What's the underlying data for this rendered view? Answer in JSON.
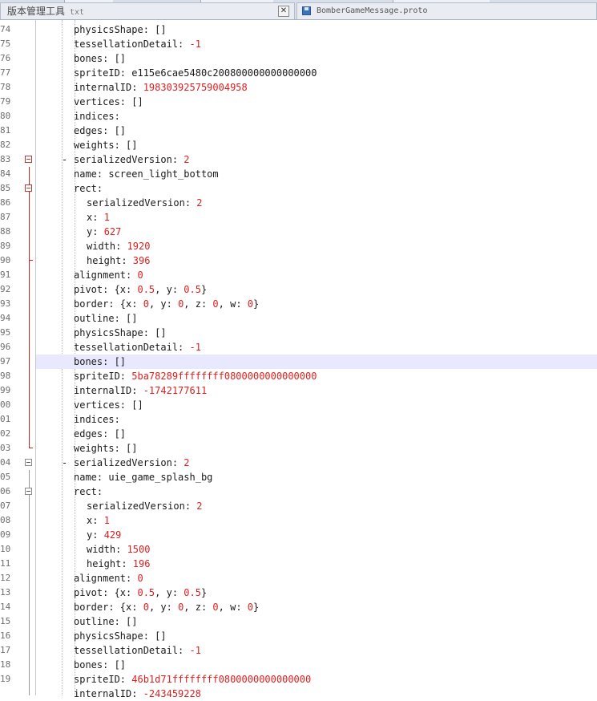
{
  "tabs": [
    {
      "label": "版本管理工具",
      "ext": "txt",
      "close": "✕"
    },
    {
      "label": "BomberGameMessage.proto"
    }
  ],
  "line_numbers": [
    "74",
    "75",
    "76",
    "77",
    "78",
    "79",
    "80",
    "81",
    "82",
    "83",
    "84",
    "85",
    "86",
    "87",
    "88",
    "89",
    "90",
    "91",
    "92",
    "93",
    "94",
    "95",
    "96",
    "97",
    "98",
    "99",
    "00",
    "01",
    "02",
    "03",
    "04",
    "05",
    "06",
    "07",
    "08",
    "09",
    "10",
    "11",
    "12",
    "13",
    "14",
    "15",
    "16",
    "17",
    "18",
    "19"
  ],
  "lines": [
    {
      "indent": 92,
      "dash": false,
      "key": "physicsShape: ",
      "val": "[]",
      "valColor": "k"
    },
    {
      "indent": 92,
      "dash": false,
      "key": "tessellationDetail: ",
      "val": "-1",
      "valColor": "n"
    },
    {
      "indent": 92,
      "dash": false,
      "key": "bones: ",
      "val": "[]",
      "valColor": "k"
    },
    {
      "indent": 92,
      "dash": false,
      "key": "spriteID: ",
      "val": "e115e6cae5480c200800000000000000",
      "valColor": "k"
    },
    {
      "indent": 92,
      "dash": false,
      "key": "internalID: ",
      "val": "198303925759004958",
      "valColor": "n"
    },
    {
      "indent": 92,
      "dash": false,
      "key": "vertices: ",
      "val": "[]",
      "valColor": "k"
    },
    {
      "indent": 92,
      "dash": false,
      "key": "indices:",
      "val": "",
      "valColor": "k"
    },
    {
      "indent": 92,
      "dash": false,
      "key": "edges: ",
      "val": "[]",
      "valColor": "k"
    },
    {
      "indent": 92,
      "dash": false,
      "key": "weights: ",
      "val": "[]",
      "valColor": "k"
    },
    {
      "indent": 92,
      "dash": true,
      "key": "serializedVersion: ",
      "val": "2",
      "valColor": "n"
    },
    {
      "indent": 92,
      "dash": false,
      "key": "name: ",
      "val": "screen_light_bottom",
      "valColor": "k"
    },
    {
      "indent": 92,
      "dash": false,
      "key": "rect:",
      "val": "",
      "valColor": "k"
    },
    {
      "indent": 108,
      "dash": false,
      "key": "serializedVersion: ",
      "val": "2",
      "valColor": "n"
    },
    {
      "indent": 108,
      "dash": false,
      "key": "x: ",
      "val": "1",
      "valColor": "n"
    },
    {
      "indent": 108,
      "dash": false,
      "key": "y: ",
      "val": "627",
      "valColor": "n"
    },
    {
      "indent": 108,
      "dash": false,
      "key": "width: ",
      "val": "1920",
      "valColor": "n"
    },
    {
      "indent": 108,
      "dash": false,
      "key": "height: ",
      "val": "396",
      "valColor": "n"
    },
    {
      "indent": 92,
      "dash": false,
      "key": "alignment: ",
      "val": "0",
      "valColor": "n"
    },
    {
      "indent": 92,
      "dash": false,
      "key": "pivot: ",
      "val": "{x: 0.5, y: 0.5}",
      "valColor": "mixed"
    },
    {
      "indent": 92,
      "dash": false,
      "key": "border: ",
      "val": "{x: 0, y: 0, z: 0, w: 0}",
      "valColor": "mixed"
    },
    {
      "indent": 92,
      "dash": false,
      "key": "outline: ",
      "val": "[]",
      "valColor": "k"
    },
    {
      "indent": 92,
      "dash": false,
      "key": "physicsShape: ",
      "val": "[]",
      "valColor": "k"
    },
    {
      "indent": 92,
      "dash": false,
      "key": "tessellationDetail: ",
      "val": "-1",
      "valColor": "n"
    },
    {
      "indent": 92,
      "dash": false,
      "key": "bones: ",
      "val": "[]",
      "valColor": "k",
      "highlight": true
    },
    {
      "indent": 92,
      "dash": false,
      "key": "spriteID: ",
      "val": "5ba78289ffffffff0800000000000000",
      "valColor": "n"
    },
    {
      "indent": 92,
      "dash": false,
      "key": "internalID: ",
      "val": "-1742177611",
      "valColor": "n"
    },
    {
      "indent": 92,
      "dash": false,
      "key": "vertices: ",
      "val": "[]",
      "valColor": "k"
    },
    {
      "indent": 92,
      "dash": false,
      "key": "indices:",
      "val": "",
      "valColor": "k"
    },
    {
      "indent": 92,
      "dash": false,
      "key": "edges: ",
      "val": "[]",
      "valColor": "k"
    },
    {
      "indent": 92,
      "dash": false,
      "key": "weights: ",
      "val": "[]",
      "valColor": "k"
    },
    {
      "indent": 92,
      "dash": true,
      "key": "serializedVersion: ",
      "val": "2",
      "valColor": "n"
    },
    {
      "indent": 92,
      "dash": false,
      "key": "name: ",
      "val": "uie_game_splash_bg",
      "valColor": "k"
    },
    {
      "indent": 92,
      "dash": false,
      "key": "rect:",
      "val": "",
      "valColor": "k"
    },
    {
      "indent": 108,
      "dash": false,
      "key": "serializedVersion: ",
      "val": "2",
      "valColor": "n"
    },
    {
      "indent": 108,
      "dash": false,
      "key": "x: ",
      "val": "1",
      "valColor": "n"
    },
    {
      "indent": 108,
      "dash": false,
      "key": "y: ",
      "val": "429",
      "valColor": "n"
    },
    {
      "indent": 108,
      "dash": false,
      "key": "width: ",
      "val": "1500",
      "valColor": "n"
    },
    {
      "indent": 108,
      "dash": false,
      "key": "height: ",
      "val": "196",
      "valColor": "n"
    },
    {
      "indent": 92,
      "dash": false,
      "key": "alignment: ",
      "val": "0",
      "valColor": "n"
    },
    {
      "indent": 92,
      "dash": false,
      "key": "pivot: ",
      "val": "{x: 0.5, y: 0.5}",
      "valColor": "mixed"
    },
    {
      "indent": 92,
      "dash": false,
      "key": "border: ",
      "val": "{x: 0, y: 0, z: 0, w: 0}",
      "valColor": "mixed"
    },
    {
      "indent": 92,
      "dash": false,
      "key": "outline: ",
      "val": "[]",
      "valColor": "k"
    },
    {
      "indent": 92,
      "dash": false,
      "key": "physicsShape: ",
      "val": "[]",
      "valColor": "k"
    },
    {
      "indent": 92,
      "dash": false,
      "key": "tessellationDetail: ",
      "val": "-1",
      "valColor": "n"
    },
    {
      "indent": 92,
      "dash": false,
      "key": "bones: ",
      "val": "[]",
      "valColor": "k"
    },
    {
      "indent": 92,
      "dash": false,
      "key": "spriteID: ",
      "val": "46b1d71ffffffff0800000000000000",
      "valColor": "n"
    },
    {
      "indent": 92,
      "dash": false,
      "key": "internalID: ",
      "val": "-243459228",
      "valColor": "n"
    }
  ],
  "colors": {
    "number": "#e01e1e",
    "text": "#1a1a1a",
    "highlight": "#e8e8ff",
    "fold": "#c42727"
  }
}
